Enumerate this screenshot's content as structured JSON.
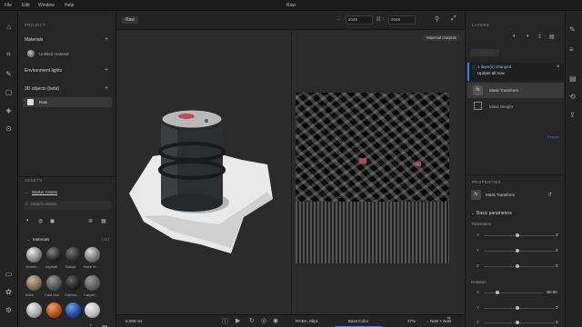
{
  "menu": {
    "file": "File",
    "edit": "Edit",
    "window": "Window",
    "help": "Help",
    "app_title": "Raw"
  },
  "left_panel": {
    "project_header": "PROJECT",
    "materials_label": "Materials",
    "material_item": "Untitled material",
    "env_lights_label": "Environment lights",
    "objects_label": "3D objects (beta)",
    "object_item": "Raw",
    "assets_header": "ASSETS",
    "starter_assets": "Starter Assets",
    "search_placeholder": "Search assets",
    "materials_group": "Materials",
    "materials_count": "(43)",
    "swatch_labels": [
      "Alumin...",
      "Asphalt",
      "Basalt",
      "Base M...",
      "Brick",
      "Cast Iron",
      "Carbon...",
      "Carpet..."
    ]
  },
  "viewport": {
    "tab_label": "Raw",
    "width_value": "2048",
    "height_value": "2048",
    "output_dropdown": "Material Outputs",
    "info_left": "5,099 ms",
    "tex_left": "RGBA, 8bpc",
    "tex_right": "NaN × NaN",
    "channel_label": "Base Color",
    "zoom_value": "27%"
  },
  "right_panel": {
    "layers_header": "LAYERS",
    "notice_title": "1 layer(s) changed",
    "notice_body": "Update all now",
    "layer1": "Mask Transform",
    "layer2": "Mask Weight",
    "link_text": "Resync",
    "properties_header": "PROPERTIES",
    "prop_title": "Mask Transform",
    "basic_params": "Basic parameters",
    "translation_label": "Translation",
    "rotation_label": "Rotation",
    "axis_x": "X",
    "axis_y": "Y",
    "axis_z": "Z",
    "t_x": "0",
    "t_y": "0",
    "t_z": "0",
    "r_x": "-80.98",
    "r_y": "0",
    "r_z": "0"
  },
  "colors": {
    "accent": "#2d7ff9",
    "panel": "#262626",
    "viewport": "#2b2b2b"
  },
  "icons": [
    "home-icon",
    "crop-icon",
    "select-icon",
    "eraser-icon",
    "layers-icon",
    "gear-icon",
    "share-icon",
    "camera-icon"
  ]
}
